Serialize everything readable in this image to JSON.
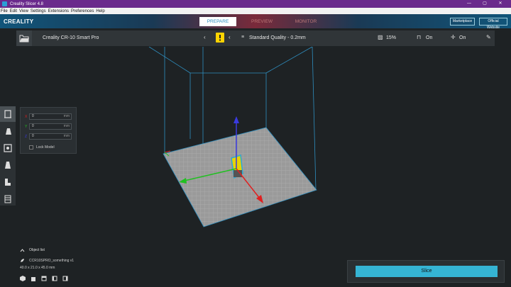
{
  "window": {
    "title": "Creality Slicer 4.8",
    "controls": [
      "—",
      "▢",
      "✕"
    ]
  },
  "menubar": {
    "items": [
      "File",
      "Edit",
      "View",
      "Settings",
      "Extensions",
      "Preferences",
      "Help"
    ]
  },
  "header": {
    "logo": "CREALITY",
    "tabs": [
      "PREPARE",
      "PREVIEW",
      "MONITOR"
    ],
    "active_tab": "PREPARE",
    "marketplace_label": "Marketplace",
    "official_website_label": "Official Website"
  },
  "printer_bar": {
    "printer_name": "Creality CR-10 Smart Pro",
    "quality_profile": "Standard Quality - 0.2mm",
    "infill": "15%",
    "support": "On",
    "adhesion": "On"
  },
  "move_panel": {
    "x_label": "X",
    "x_value": "0",
    "x_unit": "mm",
    "y_label": "Y",
    "y_value": "0",
    "y_unit": "mm",
    "z_label": "Z",
    "z_value": "0",
    "z_unit": "mm",
    "lock_label": "Lock Model"
  },
  "object_list": {
    "header": "Object list",
    "object_name": "CCR10SPRO_something v1",
    "dimensions": "40.0 x 21.0 x 45.0 mm"
  },
  "slice_panel": {
    "slice_label": "Slice"
  },
  "colors": {
    "accent": "#35b4d4",
    "title_bar": "#6a2a8c",
    "axis_x": "#e02020",
    "axis_y": "#20c020",
    "axis_z": "#3a3ae0",
    "warning": "#ffd400"
  }
}
